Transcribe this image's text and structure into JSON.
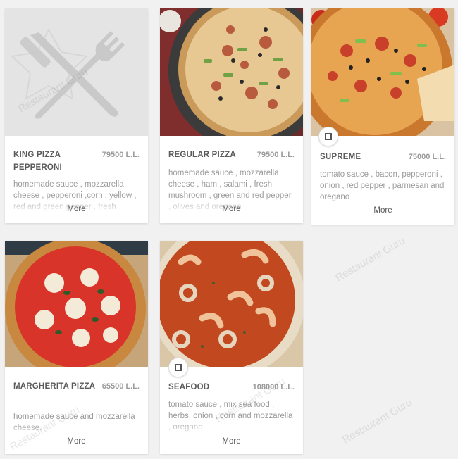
{
  "more_label": "More",
  "watermark": "Restaurant Guru",
  "items": [
    {
      "name": "KING PIZZA PEPPERONI",
      "price": "79500 L.L.",
      "description": "homemade sauce , mozzarella cheese , pepperoni ,corn , yellow , red and green pepper , fresh",
      "has_image": false
    },
    {
      "name": "REGULAR PIZZA",
      "price": "79500 L.L.",
      "description": "homemade sauce , mozzarella cheese , ham , salami , fresh mushroom , green and red pepper , olives and oregano",
      "has_image": true
    },
    {
      "name": "SUPREME",
      "price": "75000 L.L.",
      "description": "tomato sauce , bacon, pepperoni , onion , red pepper , parmesan and oregano",
      "has_image": true
    },
    {
      "name": "MARGHERITA PIZZA",
      "price": "65500 L.L.",
      "description": "homemade sauce and mozzarella cheese.",
      "has_image": true
    },
    {
      "name": "SEAFOOD",
      "price": "108000 L.L.",
      "description": "tomato sauce , mix sea food , herbs, onion , corn and mozzarella , oregano",
      "has_image": true
    }
  ]
}
